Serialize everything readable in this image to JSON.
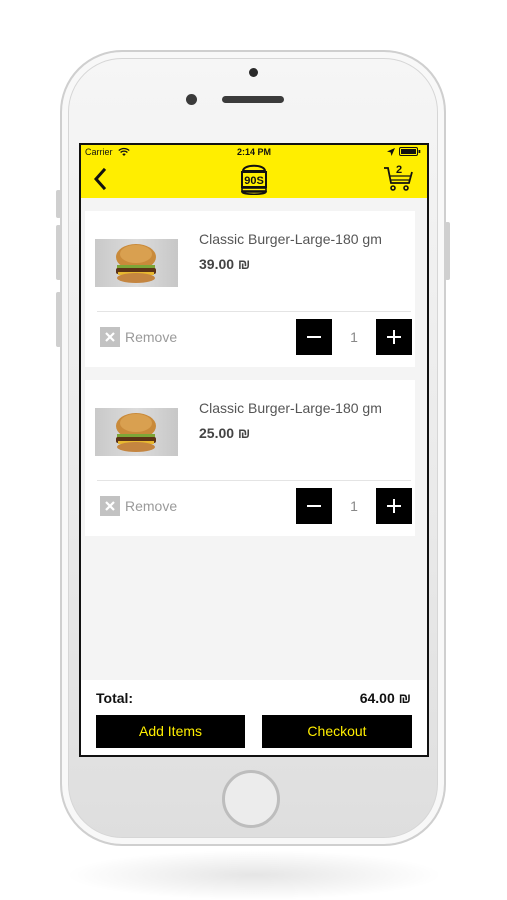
{
  "status_bar": {
    "carrier": "Carrier",
    "time": "2:14 PM"
  },
  "header": {
    "logo_text": "90S",
    "cart_count": "2",
    "accent_color": "#ffee00"
  },
  "cart": {
    "items": [
      {
        "name": "Classic Burger-Large-180 gm",
        "price": "39.00 ₪",
        "remove_label": "Remove",
        "quantity": "1"
      },
      {
        "name": "Classic Burger-Large-180 gm",
        "price": "25.00 ₪",
        "remove_label": "Remove",
        "quantity": "1"
      }
    ]
  },
  "footer": {
    "total_label": "Total:",
    "total_value": "64.00 ₪",
    "add_items_label": "Add Items",
    "checkout_label": "Checkout"
  },
  "icons": [
    "back-arrow-icon",
    "cart-icon",
    "wifi-icon",
    "location-icon",
    "battery-icon",
    "remove-x-icon",
    "minus-icon",
    "plus-icon"
  ]
}
